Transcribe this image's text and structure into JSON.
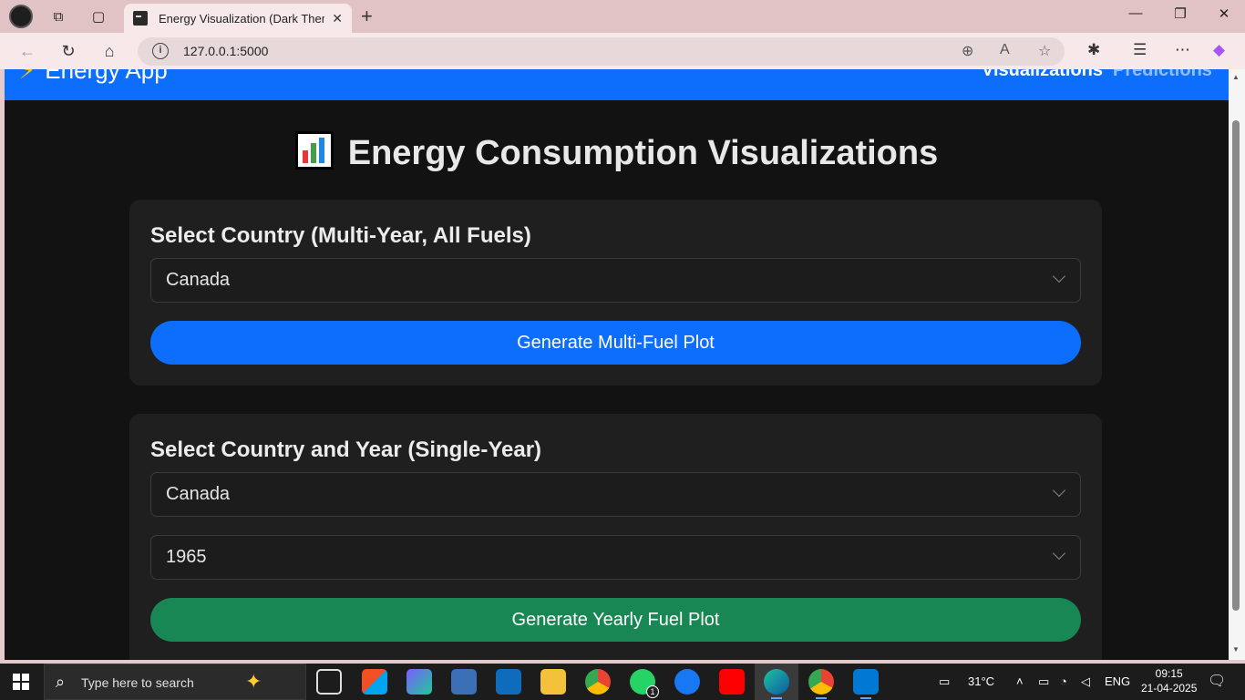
{
  "browser": {
    "tab_title": "Energy Visualization (Dark Theme)",
    "tab_close": "✕",
    "new_tab": "+",
    "url": "127.0.0.1:5000"
  },
  "app": {
    "brand": "Energy App",
    "nav_links": [
      "Visualizations",
      "Predictions"
    ]
  },
  "page": {
    "title": "Energy Consumption Visualizations",
    "multi_year": {
      "heading": "Select Country (Multi-Year, All Fuels)",
      "country_value": "Canada",
      "button_label": "Generate Multi-Fuel Plot",
      "button_color": "#0d6efd"
    },
    "single_year": {
      "heading": "Select Country and Year (Single-Year)",
      "country_value": "Canada",
      "year_value": "1965",
      "button_label": "Generate Yearly Fuel Plot",
      "button_color": "#198754"
    }
  },
  "taskbar": {
    "search_placeholder": "Type here to search",
    "weather": "31°C",
    "language": "ENG",
    "time": "09:15",
    "date": "21-04-2025",
    "whatsapp_badge": "1"
  }
}
